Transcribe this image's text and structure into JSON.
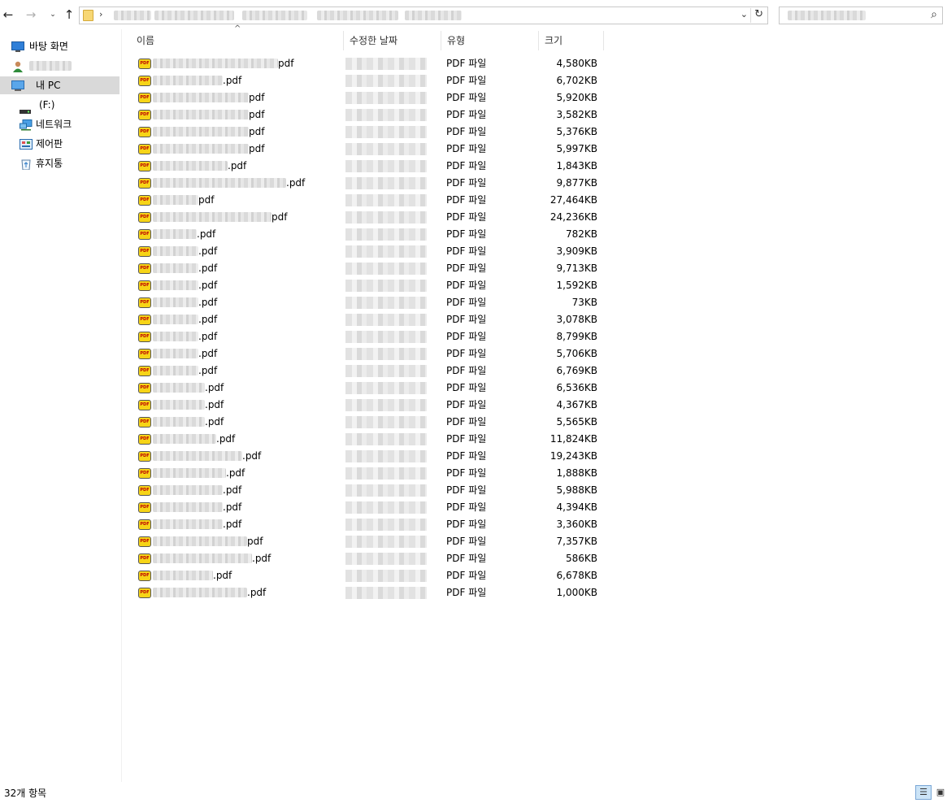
{
  "nav": {
    "back_icon": "←",
    "forward_icon": "→",
    "recent_icon": "⌄",
    "up_icon": "↑",
    "address_separator": "›",
    "dropdown_icon": "⌄",
    "refresh_icon": "↻",
    "search_icon": "⌕"
  },
  "sidebar": {
    "items": [
      {
        "label": "바탕 화면",
        "icon": "desktop-icon"
      },
      {
        "label": "",
        "icon": "user-icon"
      },
      {
        "label": "내 PC",
        "icon": "this-pc-icon",
        "selected": true
      },
      {
        "label": "(F:)",
        "icon": "drive-icon"
      },
      {
        "label": "네트워크",
        "icon": "network-icon"
      },
      {
        "label": "제어판",
        "icon": "control-panel-icon"
      },
      {
        "label": "휴지통",
        "icon": "recycle-bin-icon"
      }
    ]
  },
  "columns": {
    "name": "이름",
    "date": "수정한 날짜",
    "type": "유형",
    "size": "크기",
    "sort_icon": "^"
  },
  "files": [
    {
      "ext": "pdf",
      "type": "PDF 파일",
      "size": "4,580KB"
    },
    {
      "ext": ".pdf",
      "type": "PDF 파일",
      "size": "6,702KB"
    },
    {
      "ext": "pdf",
      "type": "PDF 파일",
      "size": "5,920KB"
    },
    {
      "ext": "pdf",
      "type": "PDF 파일",
      "size": "3,582KB"
    },
    {
      "ext": "pdf",
      "type": "PDF 파일",
      "size": "5,376KB"
    },
    {
      "ext": "pdf",
      "type": "PDF 파일",
      "size": "5,997KB"
    },
    {
      "ext": ".pdf",
      "type": "PDF 파일",
      "size": "1,843KB"
    },
    {
      "ext": ".pdf",
      "type": "PDF 파일",
      "size": "9,877KB"
    },
    {
      "ext": "pdf",
      "type": "PDF 파일",
      "size": "27,464KB"
    },
    {
      "ext": "pdf",
      "type": "PDF 파일",
      "size": "24,236KB"
    },
    {
      "ext": ".pdf",
      "type": "PDF 파일",
      "size": "782KB"
    },
    {
      "ext": ".pdf",
      "type": "PDF 파일",
      "size": "3,909KB"
    },
    {
      "ext": ".pdf",
      "type": "PDF 파일",
      "size": "9,713KB"
    },
    {
      "ext": ".pdf",
      "type": "PDF 파일",
      "size": "1,592KB"
    },
    {
      "ext": ".pdf",
      "type": "PDF 파일",
      "size": "73KB"
    },
    {
      "ext": ".pdf",
      "type": "PDF 파일",
      "size": "3,078KB"
    },
    {
      "ext": ".pdf",
      "type": "PDF 파일",
      "size": "8,799KB"
    },
    {
      "ext": ".pdf",
      "type": "PDF 파일",
      "size": "5,706KB"
    },
    {
      "ext": ".pdf",
      "type": "PDF 파일",
      "size": "6,769KB"
    },
    {
      "ext": ".pdf",
      "type": "PDF 파일",
      "size": "6,536KB"
    },
    {
      "ext": ".pdf",
      "type": "PDF 파일",
      "size": "4,367KB"
    },
    {
      "ext": ".pdf",
      "type": "PDF 파일",
      "size": "5,565KB"
    },
    {
      "ext": ".pdf",
      "type": "PDF 파일",
      "size": "11,824KB"
    },
    {
      "ext": ".pdf",
      "type": "PDF 파일",
      "size": "19,243KB"
    },
    {
      "ext": ".pdf",
      "type": "PDF 파일",
      "size": "1,888KB"
    },
    {
      "ext": ".pdf",
      "type": "PDF 파일",
      "size": "5,988KB"
    },
    {
      "ext": ".pdf",
      "type": "PDF 파일",
      "size": "4,394KB"
    },
    {
      "ext": ".pdf",
      "type": "PDF 파일",
      "size": "3,360KB"
    },
    {
      "ext": "pdf",
      "type": "PDF 파일",
      "size": "7,357KB"
    },
    {
      "ext": ".pdf",
      "type": "PDF 파일",
      "size": "586KB"
    },
    {
      "ext": ".pdf",
      "type": "PDF 파일",
      "size": "6,678KB"
    },
    {
      "ext": ".pdf",
      "type": "PDF 파일",
      "size": "1,000KB"
    }
  ],
  "status": {
    "item_count": "32개 항목"
  }
}
